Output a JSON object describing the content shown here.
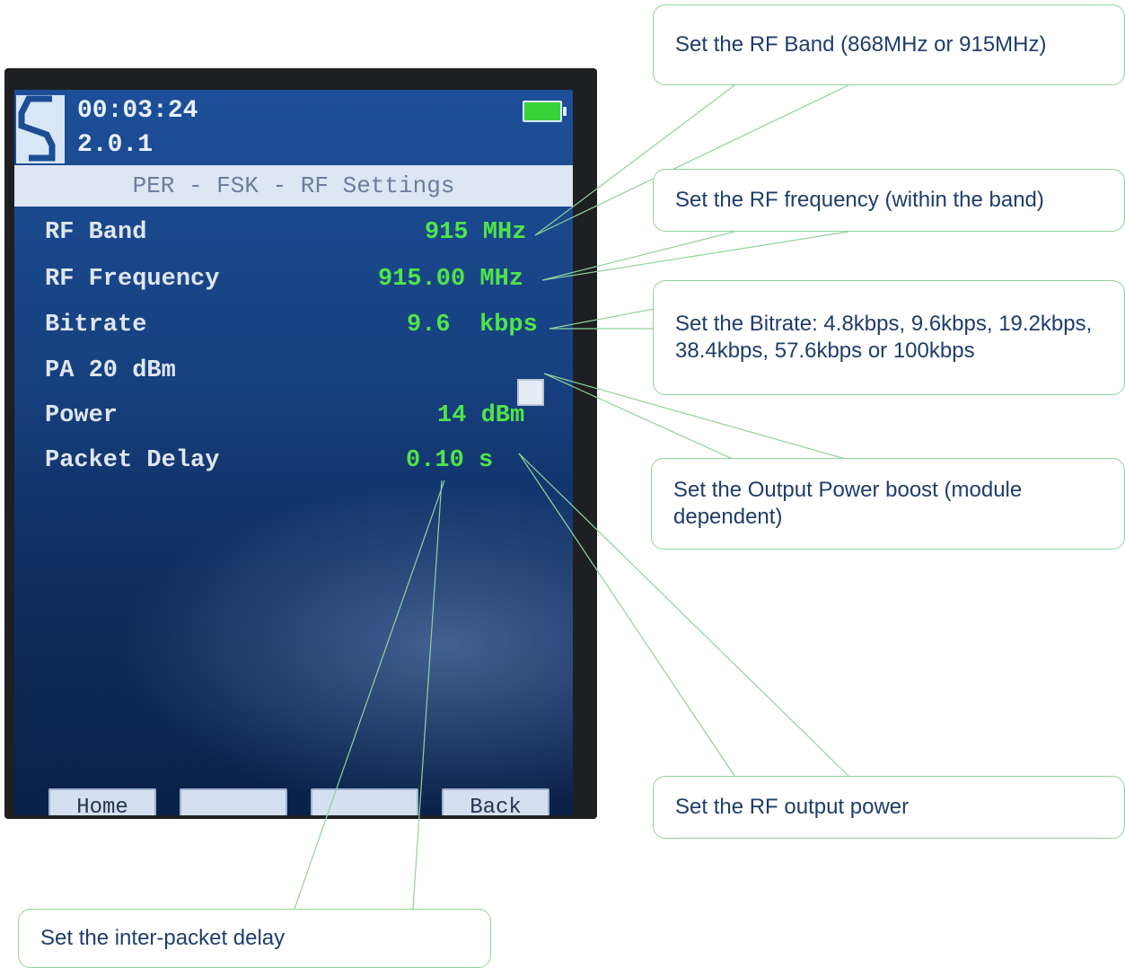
{
  "device": {
    "status": {
      "time": "00:03:24",
      "version": "2.0.1"
    },
    "title": "PER - FSK - RF Settings",
    "settings": [
      {
        "label": "RF Band",
        "value": "915 MHz"
      },
      {
        "label": "RF Frequency",
        "value": "915.00 MHz"
      },
      {
        "label": "Bitrate",
        "value": "9.6  kbps"
      },
      {
        "label": "PA 20 dBm",
        "value": ""
      },
      {
        "label": "Power",
        "value": "14 dBm"
      },
      {
        "label": "Packet Delay",
        "value": "0.10 s"
      }
    ],
    "softkeys": [
      "Home",
      "",
      "",
      "Back"
    ]
  },
  "callouts": {
    "rf_band": "Set the RF Band (868MHz or 915MHz)",
    "rf_frequency": "Set the RF frequency (within the band)",
    "bitrate": "Set the Bitrate: 4.8kbps, 9.6kbps, 19.2kbps, 38.4kbps, 57.6kbps or 100kbps",
    "pa_boost": "Set the Output Power boost (module dependent)",
    "power": "Set the RF output power",
    "packet_delay": "Set the inter-packet delay"
  },
  "colors": {
    "value_text": "#4fe44a",
    "label_text": "#dfe6ef",
    "screen_bg": "#17407f",
    "callout_border": "#8fd39a",
    "callout_text": "#1f3d6b"
  }
}
